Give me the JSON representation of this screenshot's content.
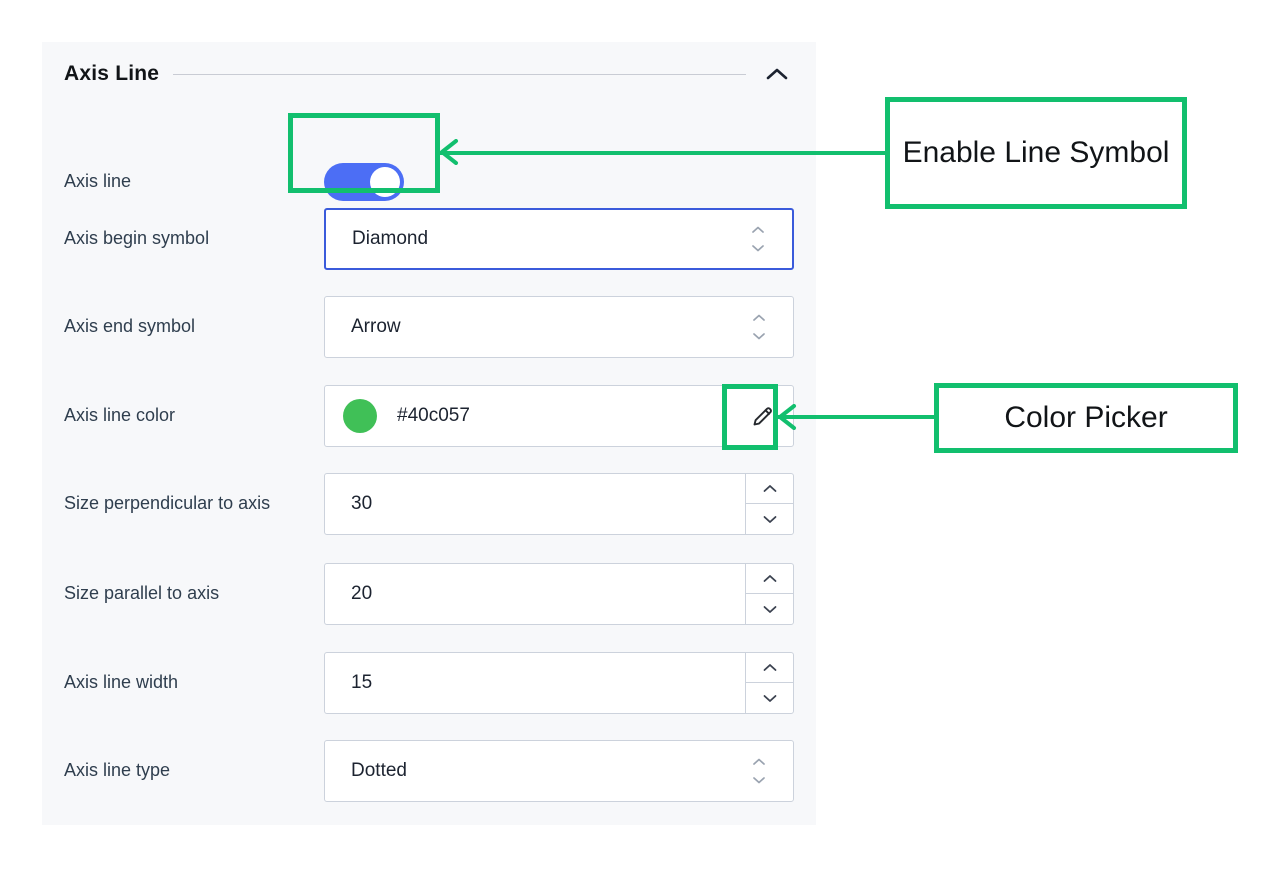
{
  "panel": {
    "title": "Axis Line",
    "collapse_icon": "chevron-up-icon"
  },
  "rows": [
    {
      "label": "Axis line",
      "type": "toggle",
      "value": "on",
      "accent": "#4c6ef5"
    },
    {
      "label": "Axis begin symbol",
      "type": "select",
      "value": "Diamond",
      "focused": true
    },
    {
      "label": "Axis end symbol",
      "type": "select",
      "value": "Arrow",
      "focused": false
    },
    {
      "label": "Axis line color",
      "type": "color",
      "value": "#40c057",
      "swatch": "#40c057",
      "edit_icon": "pencil-icon"
    },
    {
      "label": "Size perpendicular to axis",
      "type": "number",
      "value": "30"
    },
    {
      "label": "Size parallel to axis",
      "type": "number",
      "value": "20"
    },
    {
      "label": "Axis line width",
      "type": "number",
      "value": "15"
    },
    {
      "label": "Axis line type",
      "type": "select",
      "value": "Dotted",
      "focused": false
    }
  ],
  "annotations": [
    {
      "text": "Enable Line Symbol",
      "target": "axis-line-toggle",
      "color": "#12bf6e"
    },
    {
      "text": "Color Picker",
      "target": "color-picker-button",
      "color": "#12bf6e"
    }
  ]
}
